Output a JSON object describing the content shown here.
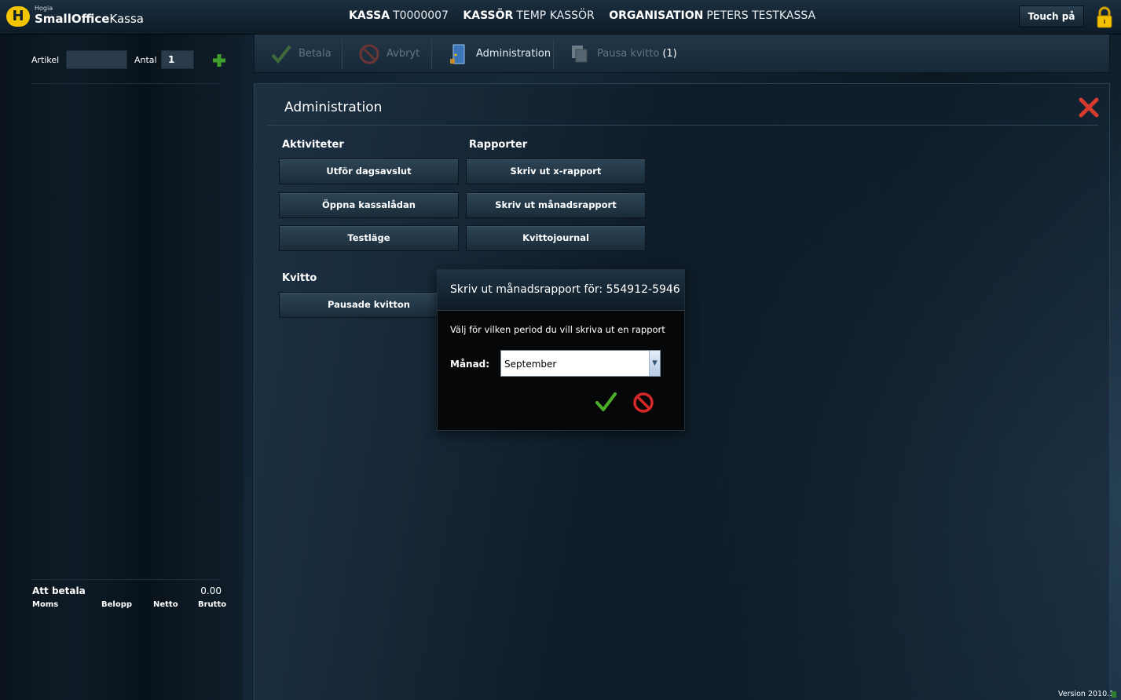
{
  "app": {
    "brand_small": "Hogia",
    "brand_main_bold": "SmallOffice",
    "brand_main_light": "Kassa",
    "logo_letter": "H"
  },
  "session": {
    "kassa_label": "KASSA",
    "kassa_value": "T0000007",
    "kassor_label": "KASSÖR",
    "kassor_value": "TEMP KASSÖR",
    "org_label": "ORGANISATION",
    "org_value": "PETERS TESTKASSA"
  },
  "header": {
    "touch_label": "Touch på",
    "lock_icon": "lock-icon"
  },
  "entry": {
    "artikel_label": "Artikel",
    "artikel_value": "",
    "antal_label": "Antal",
    "antal_value": "1"
  },
  "summary": {
    "att_betala_label": "Att betala",
    "att_betala_value": "0.00",
    "columns": [
      "Moms",
      "Belopp",
      "Netto",
      "Brutto"
    ]
  },
  "toolbar": {
    "betala": "Betala",
    "avbryt": "Avbryt",
    "administration": "Administration",
    "pausa": "Pausa kvitto",
    "pausa_count": "(1)"
  },
  "admin": {
    "title": "Administration",
    "aktiviteter_title": "Aktiviteter",
    "aktiviteter": [
      "Utför dagsavslut",
      "Öppna kassalådan",
      "Testläge"
    ],
    "rapporter_title": "Rapporter",
    "rapporter": [
      "Skriv ut x-rapport",
      "Skriv ut månadsrapport",
      "Kvittojournal"
    ],
    "kvitto_title": "Kvitto",
    "kvitto": [
      "Pausade kvitton"
    ]
  },
  "dialog": {
    "title": "Skriv ut månadsrapport för: 554912-5946",
    "text": "Välj för vilken period du vill skriva ut en rapport",
    "month_label": "Månad:",
    "month_value": "September"
  },
  "footer": {
    "version": "Version 2010.1"
  },
  "colors": {
    "accent_green": "#4caf2a",
    "cancel_red": "#d62828",
    "logo_yellow": "#f3c400"
  }
}
